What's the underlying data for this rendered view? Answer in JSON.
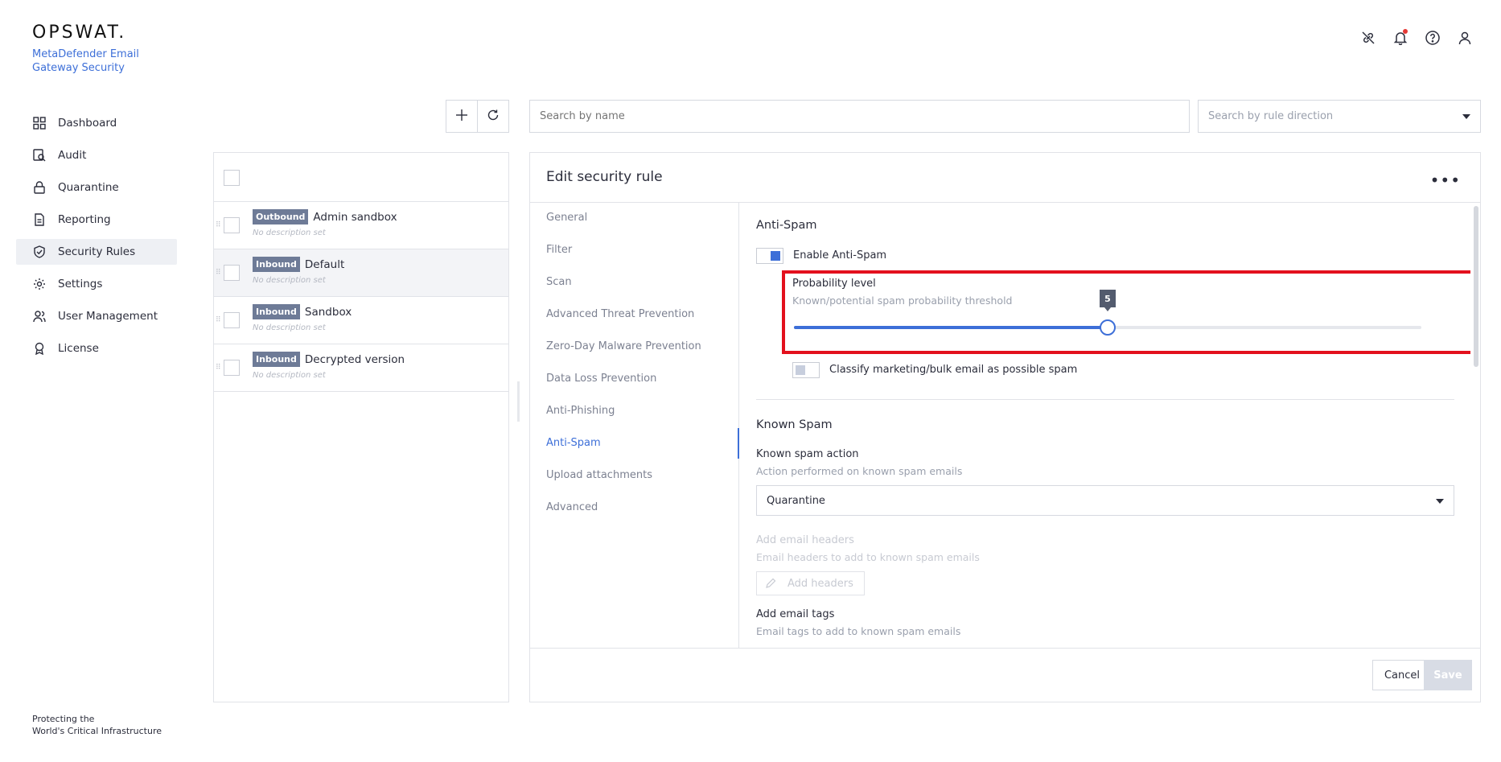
{
  "brand": {
    "logo": "OPSWAT.",
    "product": "MetaDefender Email Gateway Security"
  },
  "nav": {
    "items": [
      {
        "label": "Dashboard",
        "icon": "dashboard-icon"
      },
      {
        "label": "Audit",
        "icon": "audit-icon"
      },
      {
        "label": "Quarantine",
        "icon": "lock-icon"
      },
      {
        "label": "Reporting",
        "icon": "document-icon"
      },
      {
        "label": "Security Rules",
        "icon": "shield-check-icon",
        "active": true
      },
      {
        "label": "Settings",
        "icon": "gear-icon"
      },
      {
        "label": "User Management",
        "icon": "users-icon"
      },
      {
        "label": "License",
        "icon": "award-icon"
      }
    ]
  },
  "footer": {
    "line1": "Protecting the",
    "line2": "World's Critical Infrastructure"
  },
  "search": {
    "name_placeholder": "Search by name",
    "direction_placeholder": "Search by rule direction"
  },
  "rules": [
    {
      "direction": "Outbound",
      "name": "Admin sandbox",
      "description": "No description set"
    },
    {
      "direction": "Inbound",
      "name": "Default",
      "description": "No description set",
      "selected": true
    },
    {
      "direction": "Inbound",
      "name": "Sandbox",
      "description": "No description set"
    },
    {
      "direction": "Inbound",
      "name": "Decrypted version",
      "description": "No description set"
    }
  ],
  "edit": {
    "title": "Edit security rule",
    "tabs": [
      "General",
      "Filter",
      "Scan",
      "Advanced Threat Prevention",
      "Zero-Day Malware Prevention",
      "Data Loss Prevention",
      "Anti-Phishing",
      "Anti-Spam",
      "Upload attachments",
      "Advanced"
    ],
    "active_tab": "Anti-Spam",
    "anti_spam": {
      "heading": "Anti-Spam",
      "enable_label": "Enable Anti-Spam",
      "enabled": true,
      "probability_label": "Probability level",
      "probability_sub": "Known/potential spam probability threshold",
      "probability_value": "5",
      "probability_fraction": 0.5,
      "classify_label": "Classify marketing/bulk email as possible spam",
      "classify_enabled": false
    },
    "known_spam": {
      "heading": "Known Spam",
      "action_label": "Known spam action",
      "action_sub": "Action performed on known spam emails",
      "action_value": "Quarantine",
      "headers_label": "Add email headers",
      "headers_sub": "Email headers to add to known spam emails",
      "headers_button": "Add headers",
      "tags_label": "Add email tags",
      "tags_sub": "Email tags to add to known spam emails"
    },
    "cancel_label": "Cancel",
    "save_label": "Save"
  },
  "colors": {
    "accent": "#3d6fd8",
    "highlight": "#e3101d",
    "badge": "#6e7b97"
  }
}
